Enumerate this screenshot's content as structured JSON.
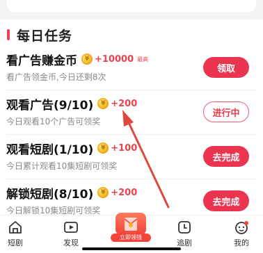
{
  "section": {
    "title": "每日任务"
  },
  "tasks": [
    {
      "title": "看广告赚金币",
      "reward": "+10000",
      "tag": "最高",
      "desc": "看广告领金币,今日还剩8次",
      "button": "领取",
      "button_style": "solid"
    },
    {
      "title": "观看广告(9/10)",
      "reward": "+200",
      "tag": "",
      "desc": "今日观看10个广告可领奖",
      "button": "进行中",
      "button_style": "outline"
    },
    {
      "title": "观看短剧(1/10)",
      "reward": "+100",
      "tag": "",
      "desc": "今日累计观看10集短剧可领奖",
      "button": "去完成",
      "button_style": "solid"
    },
    {
      "title": "解锁短剧(8/10)",
      "reward": "+200",
      "tag": "",
      "desc": "今日解锁10集短剧可领奖",
      "button": "去完成",
      "button_style": "solid"
    }
  ],
  "tabbar": {
    "items": [
      {
        "label": "短剧",
        "icon": "home-icon"
      },
      {
        "label": "发现",
        "icon": "play-icon"
      },
      {
        "label": "立即领钱",
        "icon": "red-envelope-icon"
      },
      {
        "label": "追剧",
        "icon": "bookmark-icon"
      },
      {
        "label": "我的",
        "icon": "profile-icon"
      }
    ]
  },
  "colors": {
    "accent": "#ea3450",
    "reward": "#e9444d",
    "arrow": "#e0483e"
  }
}
